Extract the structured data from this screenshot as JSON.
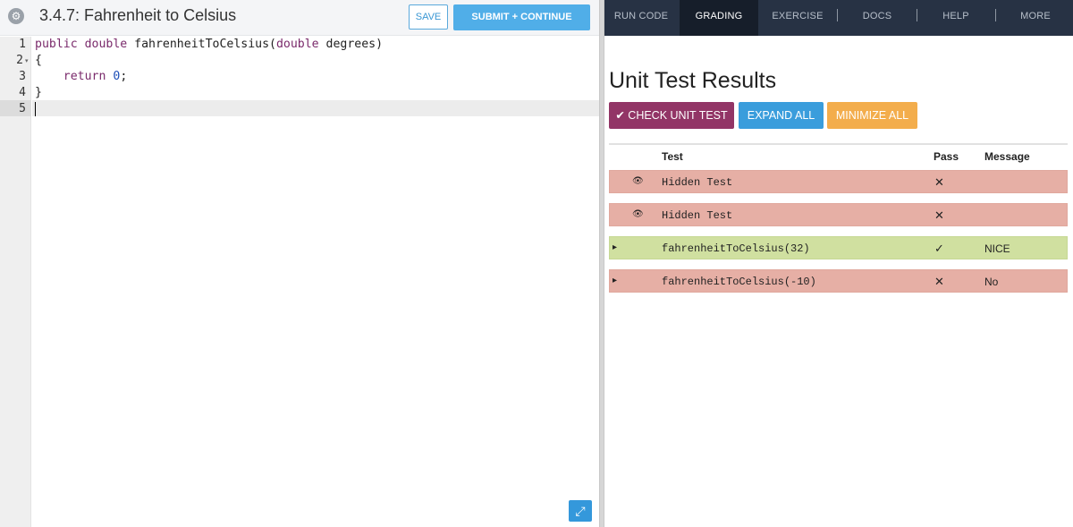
{
  "header": {
    "title": "3.4.7: Fahrenheit to Celsius",
    "save_label": "SAVE",
    "submit_label": "SUBMIT + CONTINUE",
    "settings_icon": "⚙"
  },
  "editor": {
    "line_numbers": [
      "1",
      "2",
      "3",
      "4",
      "5"
    ],
    "fold_marker": "▾",
    "lines": [
      {
        "kw1": "public",
        "kw2": "double",
        "name": " fahrenheitToCelsius(",
        "kw3": "double",
        "rest": " degrees)"
      },
      {
        "text": "{"
      },
      {
        "indent": "    ",
        "kw": "return",
        "space": " ",
        "num": "0",
        "semi": ";"
      },
      {
        "text": "}"
      },
      {
        "text": ""
      }
    ],
    "expand_icon": "⤢"
  },
  "nav": {
    "items": [
      "RUN CODE",
      "GRADING",
      "EXERCISE",
      "DOCS",
      "HELP",
      "MORE"
    ],
    "active": "GRADING"
  },
  "results": {
    "title": "Unit Test Results",
    "check_label": "✔ CHECK UNIT TEST",
    "expand_all_label": "EXPAND ALL",
    "minimize_all_label": "MINIMIZE ALL",
    "columns": [
      "Test",
      "Pass",
      "Message"
    ],
    "rows": [
      {
        "icon": "hidden-eye-icon",
        "glyph": "👁",
        "test": "Hidden Test",
        "pass": "✕",
        "message": "",
        "status": "fail"
      },
      {
        "icon": "hidden-eye-icon",
        "glyph": "👁",
        "test": "Hidden Test",
        "pass": "✕",
        "message": "",
        "status": "fail"
      },
      {
        "icon": "caret-right-icon",
        "glyph": "▸",
        "test": "fahrenheitToCelsius(32)",
        "pass": "✓",
        "message": "NICE",
        "status": "pass"
      },
      {
        "icon": "caret-right-icon",
        "glyph": "▸",
        "test": "fahrenheitToCelsius(-10)",
        "pass": "✕",
        "message": "No",
        "status": "fail"
      }
    ]
  },
  "colors": {
    "nav_bg": "#273244",
    "nav_active_bg": "#161e2a",
    "fail_row": "#e6afa5",
    "pass_row": "#d0e0a0",
    "check_button": "#923566",
    "expand_button": "#3a9ddc",
    "minimize_button": "#f3ad4c",
    "submit_button": "#50aee8"
  }
}
